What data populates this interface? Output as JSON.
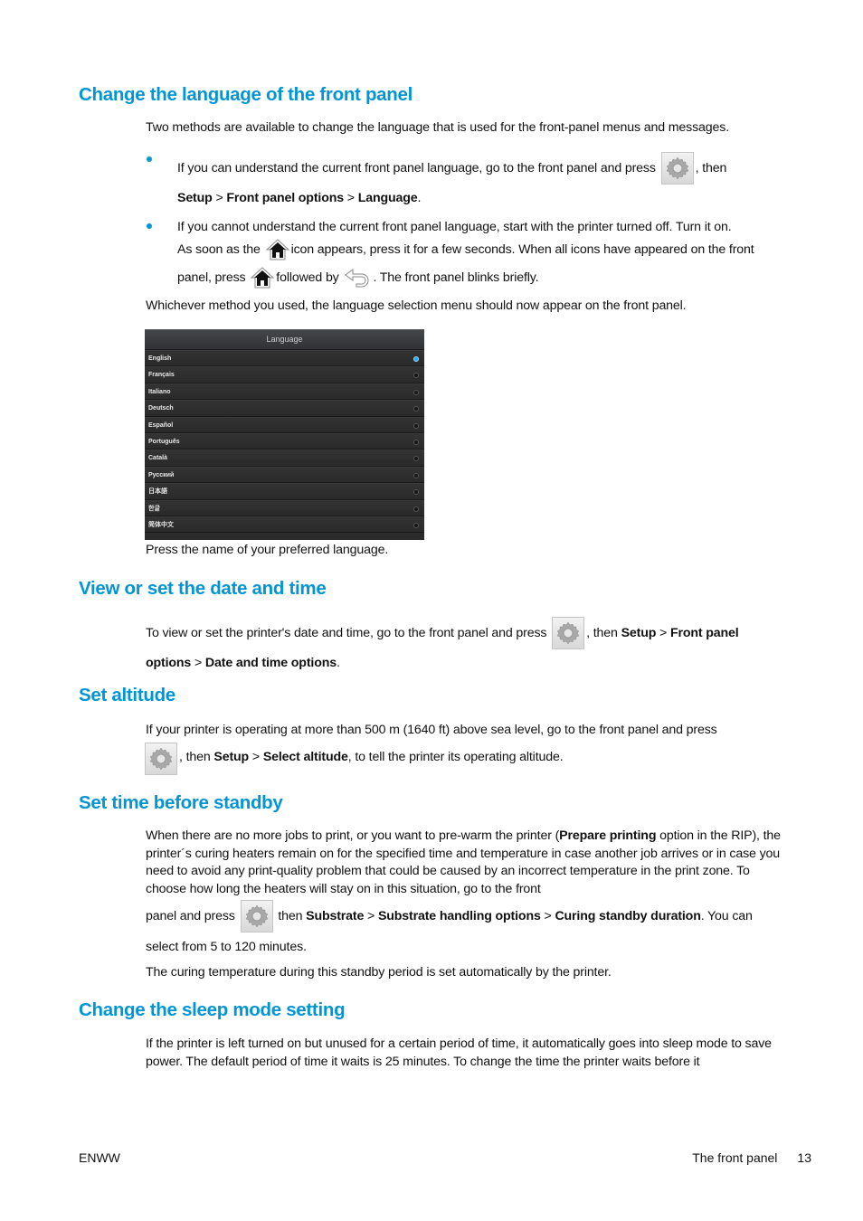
{
  "sections": {
    "language": {
      "heading": "Change the language of the front panel",
      "intro": "Two methods are available to change the language that is used for the front-panel menus and messages.",
      "bullet1": {
        "text_before_icon": "If you can understand the current front panel language, go to the front panel and press",
        "text_after_icon": ", then",
        "path": [
          "Setup",
          "Front panel options",
          "Language"
        ],
        "sep": " > ",
        "end": "."
      },
      "bullet2": {
        "line1": "If you cannot understand the current front panel language, start with the printer turned off. Turn it on.",
        "line2_before": "As soon as the",
        "line2_after": "icon appears, press it for a few seconds. When all icons have appeared on the front",
        "line3_before": "panel, press",
        "line3_mid": "followed by",
        "line3_after": ". The front panel blinks briefly."
      },
      "after_bullets": "Whichever method you used, the language selection menu should now appear on the front panel.",
      "panel": {
        "title": "Language",
        "options": [
          {
            "label": "English",
            "selected": true
          },
          {
            "label": "Français",
            "selected": false
          },
          {
            "label": "Italiano",
            "selected": false
          },
          {
            "label": "Deutsch",
            "selected": false
          },
          {
            "label": "Español",
            "selected": false
          },
          {
            "label": "Português",
            "selected": false
          },
          {
            "label": "Català",
            "selected": false
          },
          {
            "label": "Русский",
            "selected": false
          },
          {
            "label": "日本語",
            "selected": false
          },
          {
            "label": "한글",
            "selected": false
          },
          {
            "label": "简体中文",
            "selected": false
          }
        ]
      },
      "caption": "Press the name of your preferred language."
    },
    "datetime": {
      "heading": "View or set the date and time",
      "text_before_icon": "To view or set the printer's date and time, go to the front panel and press",
      "text_after_icon": ", then",
      "path": [
        "Setup",
        "Front panel",
        "options",
        "Date and time options"
      ],
      "end": "."
    },
    "altitude": {
      "heading": "Set altitude",
      "line1": "If your printer is operating at more than 500 m (1640 ft) above sea level, go to the front panel and press",
      "after_icon": ", then",
      "path": [
        "Setup",
        "Select altitude"
      ],
      "end": ", to tell the printer its operating altitude."
    },
    "standby": {
      "heading": "Set time before standby",
      "p1_before": "When there are no more jobs to print, or you want to pre-warm the printer (",
      "p1_bold": "Prepare printing",
      "p1_after": " option in the RIP), the printer´s curing heaters remain on for the specified time and temperature in case another job arrives or in case you need to avoid any print-quality problem that could be caused by an incorrect temperature in the print zone. To choose how long the heaters will stay on in this situation, go to the front",
      "p1_line5_before": "panel and press",
      "p1_line5_after": "then",
      "path": [
        "Substrate",
        "Substrate handling options",
        "Curing standby duration"
      ],
      "p1_end": ". You can",
      "p1_last": "select from 5 to 120 minutes.",
      "p2": "The curing temperature during this standby period is set automatically by the printer."
    },
    "sleep": {
      "heading": "Change the sleep mode setting",
      "p1": "If the printer is left turned on but unused for a certain period of time, it automatically goes into sleep mode to save power. The default period of time it waits is 25 minutes. To change the time the printer waits before it"
    }
  },
  "footer": {
    "left": "ENWW",
    "section": "The front panel",
    "page": "13"
  },
  "icons": {
    "settings": "gear-icon",
    "home": "home-icon",
    "back": "back-arrow-icon"
  },
  "colors": {
    "heading": "#0096d6",
    "bullet": "#0096d6",
    "selected_radio": "#2aa8f0"
  }
}
